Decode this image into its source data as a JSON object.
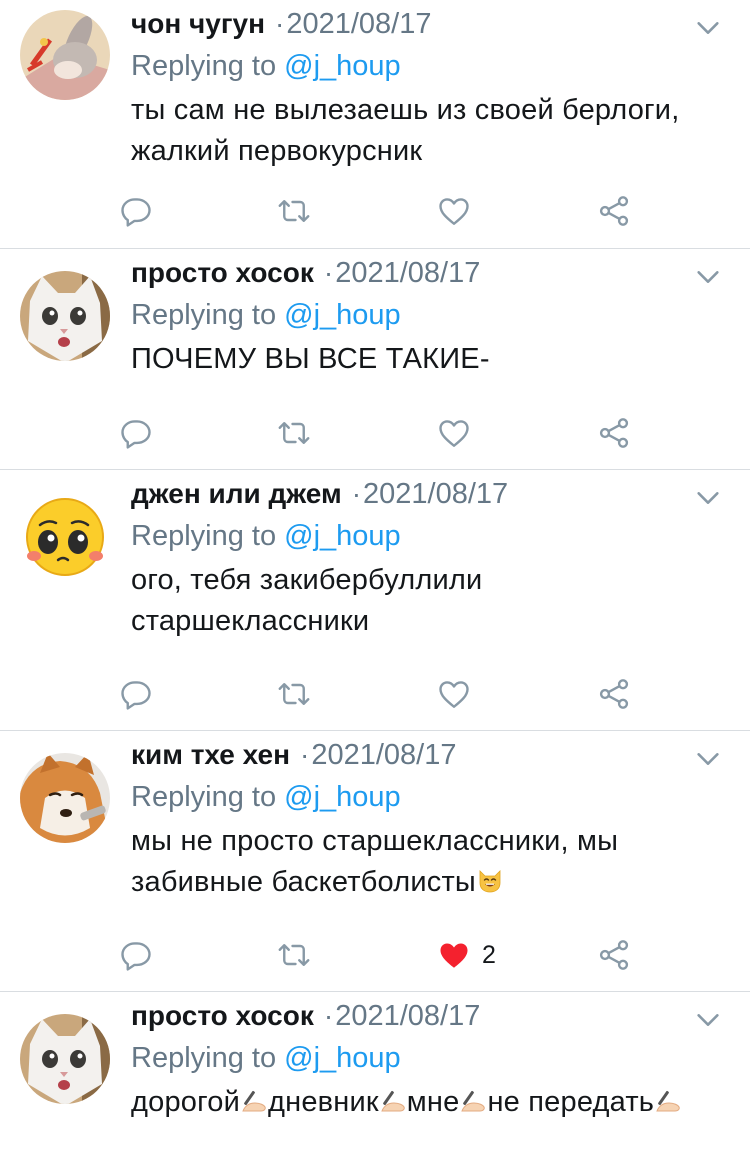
{
  "tweets": [
    {
      "name": "чон чугун",
      "sep": "·",
      "date": "2021/08/17",
      "reply_prefix": "Replying to",
      "handle": "@j_houp",
      "lines": [
        "ты сам не вылезаешь из своей берлоги,",
        "жалкий первокурсник"
      ],
      "avatar": "bunny-avatar",
      "like_count": "",
      "liked": false
    },
    {
      "name": "просто хосок",
      "sep": "·",
      "date": "2021/08/17",
      "reply_prefix": "Replying to",
      "handle": "@j_houp",
      "lines": [
        "ПОЧЕМУ ВЫ ВСЕ ТАКИЕ-"
      ],
      "avatar": "cat-avatar",
      "like_count": "",
      "liked": false
    },
    {
      "name": "джен или джем",
      "sep": "·",
      "date": "2021/08/17",
      "reply_prefix": "Replying to",
      "handle": "@j_houp",
      "lines": [
        "ого, тебя закибербуллили",
        "старшеклассники"
      ],
      "avatar": "emoji-face-avatar",
      "like_count": "",
      "liked": false
    },
    {
      "name": "ким тхе хен",
      "sep": "·",
      "date": "2021/08/17",
      "reply_prefix": "Replying to",
      "handle": "@j_houp",
      "lines": [
        "мы не просто старшеклассники, мы",
        "забивные баскетболисты"
      ],
      "avatar": "dog-avatar",
      "like_count": "2",
      "liked": true
    },
    {
      "name": "просто хосок",
      "sep": "·",
      "date": "2021/08/17",
      "reply_prefix": "Replying to",
      "handle": "@j_houp",
      "words": [
        "дорогой",
        "дневник",
        "мне",
        "не передать"
      ],
      "avatar": "cat-avatar",
      "like_count": "",
      "liked": false
    }
  ],
  "colors": {
    "handle": "#1d9bf0",
    "muted": "#657786",
    "like_red": "#f4212e",
    "divider": "#d9dde1"
  },
  "icons": [
    "reply-icon",
    "retweet-icon",
    "like-icon",
    "share-icon",
    "chevron-down-icon",
    "grinning-cat-emoji",
    "writing-hand-emoji"
  ]
}
